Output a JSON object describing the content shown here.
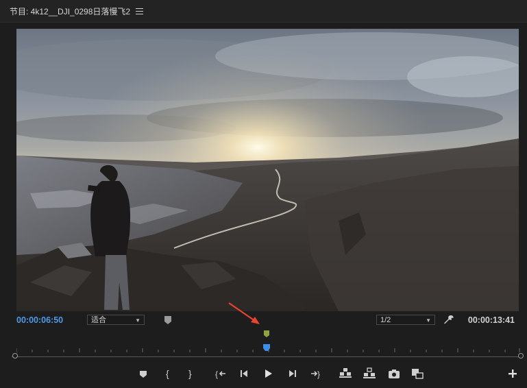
{
  "header": {
    "title": "节目: 4k12__DJI_0298日落慢飞2"
  },
  "controls": {
    "current_timecode": "00:00:06:50",
    "fit_label": "适合",
    "resolution_label": "1/2",
    "duration_timecode": "00:00:13:41"
  },
  "playhead": {
    "position_fraction": 0.49
  },
  "annotation": {
    "arrow_color": "#e8452e"
  },
  "colors": {
    "accent": "#4d9ae8",
    "in_marker": "#8fa43a"
  },
  "transport": {
    "buttons": [
      "marker-icon",
      "mark-in-icon",
      "mark-out-icon",
      "go-to-in-icon",
      "step-back-icon",
      "play-icon",
      "step-forward-icon",
      "go-to-out-icon",
      "lift-icon",
      "extract-icon",
      "export-frame-icon",
      "compare-icon",
      "add-button-icon"
    ]
  }
}
